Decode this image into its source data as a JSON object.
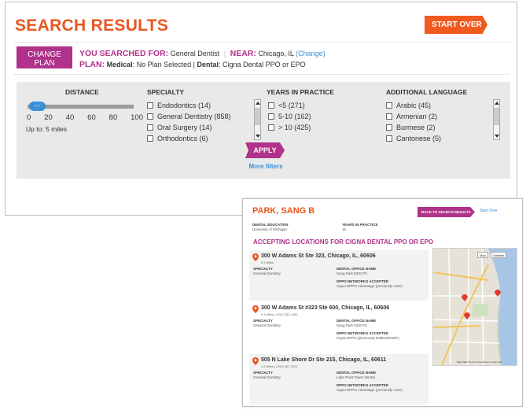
{
  "results": {
    "title": "SEARCH RESULTS",
    "start_over": "START OVER",
    "change_plan": "CHANGE PLAN",
    "searched_label": "YOU SEARCHED FOR:",
    "searched_value": "General Dentist",
    "near_label": "NEAR:",
    "near_value": "Chicago, IL",
    "change_link": "(Change)",
    "plan_label": "PLAN:",
    "plan_medical_label": "Medical",
    "plan_medical_value": ": No Plan Selected |",
    "plan_dental_label": "Dental",
    "plan_dental_value": ": Cigna Dental PPO or EPO"
  },
  "filters": {
    "distance": {
      "header": "DISTANCE",
      "ticks": [
        "0",
        "20",
        "40",
        "60",
        "80",
        "100"
      ],
      "value_text": "Up to: 5 miles",
      "value_miles": 5,
      "knob_label": "‹ ›"
    },
    "specialty": {
      "header": "SPECIALTY",
      "options": [
        "Endodontics (14)",
        "General Dentistry (858)",
        "Oral Surgery (14)",
        "Orthodontics (6)"
      ]
    },
    "years": {
      "header": "YEARS IN PRACTICE",
      "options": [
        "<5 (271)",
        "5-10 (162)",
        "> 10 (425)"
      ]
    },
    "language": {
      "header": "ADDITIONAL LANGUAGE",
      "options": [
        "Arabic (45)",
        "Armenian (2)",
        "Burmese (2)",
        "Cantonese (5)"
      ]
    },
    "apply": "APPLY",
    "more": "More filters"
  },
  "detail": {
    "name": "PARK, SANG B",
    "back_button": "BACK TO SEARCH RESULTS",
    "start_over": "Start Over",
    "education_label": "DENTAL EDUCATION",
    "education_value": "University of Michigan",
    "years_label": "YEARS IN PRACTICE",
    "years_value": "15",
    "accepting": "ACCEPTING LOCATIONS FOR CIGNA DENTAL PPO OR EPO",
    "specialty_label": "SPECIALTY",
    "office_label": "DENTAL OFFICE NAME",
    "networks_label": "DPPO NETWORKS ACCEPTED",
    "locations": [
      {
        "address": "300 W Adams St Ste 323, Chicago, IL, 60606",
        "meta": "0.3 Miles",
        "specialty": "General Dentistry",
        "office": "Sang Park DDS PC",
        "networks": "Cigna DPPO Advantage (previously Core)"
      },
      {
        "address": "300 W Adams St #323 Ste 600, Chicago, IL, 60606",
        "meta": "0.3 Miles  |  (312) 332-1450",
        "specialty": "General Dentistry",
        "office": "Sang Park DDS PC",
        "networks": "Cigna DPPO (previously Radius/DNOP)"
      },
      {
        "address": "505 N Lake Shore Dr Ste 215, Chicago, IL, 60611",
        "meta": "1.2 Miles  |  (312) 467-3201",
        "specialty": "General Dentistry",
        "office": "Lake Point Tower Dental",
        "networks": "Cigna DPPO Advantage (previously Core)"
      }
    ],
    "map": {
      "btn_map": "Map",
      "btn_satellite": "Satellite",
      "footer": "Map Data   Terms of Use   Report a map error"
    }
  },
  "colors": {
    "orange": "#e8561f",
    "magenta": "#b0328a",
    "link": "#3b8fd8",
    "filter_bg": "#e9e9e9"
  }
}
